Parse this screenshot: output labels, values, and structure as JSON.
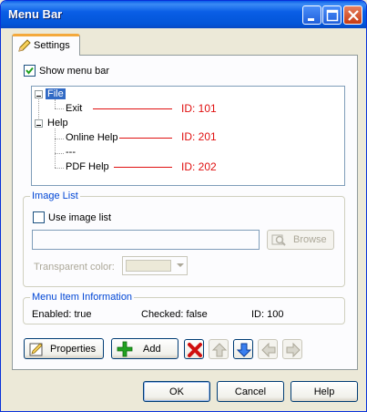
{
  "window": {
    "title": "Menu Bar"
  },
  "tabs": [
    {
      "label": "Settings"
    }
  ],
  "show_menu_bar": {
    "label": "Show menu bar",
    "checked": true
  },
  "tree": {
    "nodes": {
      "file": "File",
      "exit": "Exit",
      "help": "Help",
      "online_help": "Online Help",
      "separator": "---",
      "pdf_help": "PDF Help"
    },
    "ids": {
      "exit": "ID: 101",
      "online_help": "ID: 201",
      "pdf_help": "ID: 202"
    }
  },
  "image_list": {
    "group_title": "Image List",
    "use_image_list_label": "Use image list",
    "use_image_list_checked": false,
    "path_value": "",
    "browse_label": "Browse",
    "transparent_color_label": "Transparent color:"
  },
  "menu_item_info": {
    "group_title": "Menu Item Information",
    "enabled": "Enabled: true",
    "checked": "Checked: false",
    "id": "ID: 100"
  },
  "toolbar": {
    "properties_label": "Properties",
    "add_label": "Add"
  },
  "footer": {
    "ok_label": "OK",
    "cancel_label": "Cancel",
    "help_label": "Help"
  },
  "colors": {
    "titlebar": "#0a5de8",
    "selection": "#316ac5",
    "annotation_red": "#e01010",
    "tab_accent": "#f4a93c"
  }
}
